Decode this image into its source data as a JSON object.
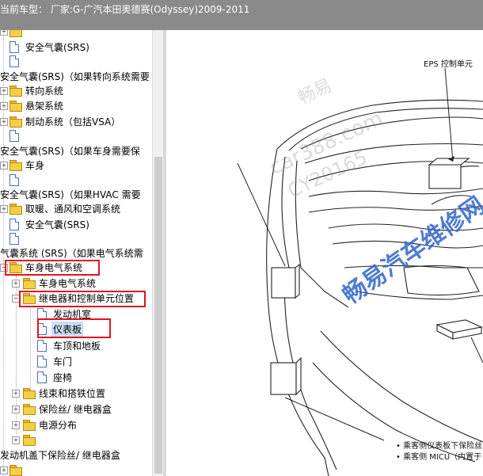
{
  "header": {
    "title": "当前车型： 厂家:G-广汽本田奥德赛(Odyssey)2009-2011"
  },
  "tree": {
    "items": [
      {
        "label": "",
        "type": "folder-partial"
      },
      {
        "label": "安全气囊(SRS)",
        "type": "doc"
      },
      {
        "label": "",
        "type": "doc"
      },
      {
        "label": "安全气囊(SRS)（如果转向系统需要",
        "type": "text"
      },
      {
        "label": "转向系统",
        "type": "folder"
      },
      {
        "label": "悬架系统",
        "type": "folder"
      },
      {
        "label": "制动系统（包括VSA）",
        "type": "folder"
      },
      {
        "label": "",
        "type": "doc"
      },
      {
        "label": "安全气囊(SRS)（如果车身需要保",
        "type": "text"
      },
      {
        "label": "车身",
        "type": "folder"
      },
      {
        "label": "",
        "type": "doc"
      },
      {
        "label": "安全气囊(SRS)（如果HVAC 需要",
        "type": "text"
      },
      {
        "label": "取暖、通风和空调系统",
        "type": "folder"
      },
      {
        "label": "安全气囊(SRS)",
        "type": "doc"
      },
      {
        "label": "",
        "type": "doc"
      },
      {
        "label": "气囊系统 (SRS)（如果电气系统需",
        "type": "text"
      },
      {
        "label": "车身电气系统",
        "type": "folder-open"
      },
      {
        "label": "车身电气系统",
        "type": "folder"
      },
      {
        "label": "继电器和控制单元位置",
        "type": "folder-open"
      },
      {
        "label": "发动机室",
        "type": "doc"
      },
      {
        "label": "仪表板",
        "type": "doc"
      },
      {
        "label": "车顶和地板",
        "type": "doc"
      },
      {
        "label": "车门",
        "type": "doc"
      },
      {
        "label": "座椅",
        "type": "doc"
      },
      {
        "label": "线束和搭铁位置",
        "type": "folder"
      },
      {
        "label": "保险丝/ 继电器盒",
        "type": "folder"
      },
      {
        "label": "电源分布",
        "type": "folder"
      },
      {
        "label": "",
        "type": "folder"
      },
      {
        "label": "发动机盖下保险丝/ 继电器盒",
        "type": "text"
      },
      {
        "label": "",
        "type": "folder"
      }
    ]
  },
  "diagram": {
    "eps_label": "EPS 控制单元",
    "note1": "• 乘客侧仪表板下保险丝",
    "note2": "• 乘客侧 MICU（内置于"
  },
  "watermarks": {
    "w1": "畅易",
    "w2": "car388.com",
    "w3": "CY20165",
    "w4": "畅易汽车维修网"
  }
}
